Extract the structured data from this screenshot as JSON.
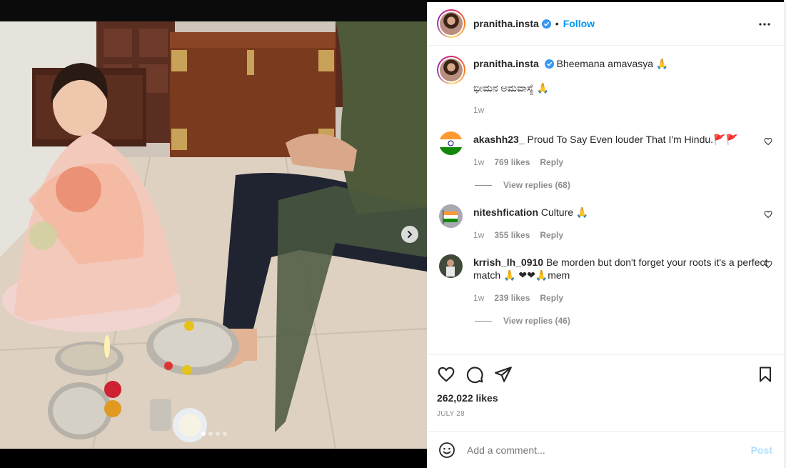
{
  "post": {
    "author": "pranitha.insta",
    "follow_label": "Follow",
    "separator": "•",
    "caption": "Bheemana amavasya 🙏",
    "caption_line2": "ಭೀಮನ ಅಮವಾಸ್ಯೆ 🙏",
    "caption_time": "1w",
    "likes": "262,022 likes",
    "date": "JULY 28"
  },
  "comments": [
    {
      "user": "akashh23_",
      "text": "Proud To Say Even louder That I'm Hindu.🚩🚩",
      "time": "1w",
      "likes": "769 likes",
      "reply_label": "Reply",
      "view_replies": "View replies (68)"
    },
    {
      "user": "niteshfication",
      "text": "Culture 🙏",
      "time": "1w",
      "likes": "355 likes",
      "reply_label": "Reply"
    },
    {
      "user": "krrish_lh_0910",
      "text": "Be morden but don't forget your roots it's a perfect match 🙏 ❤❤🙏mem",
      "time": "1w",
      "likes": "239 likes",
      "reply_label": "Reply",
      "view_replies": "View replies (46)"
    }
  ],
  "add_comment": {
    "placeholder": "Add a comment...",
    "post_label": "Post"
  },
  "carousel": {
    "slides": 4,
    "active_index": 0
  },
  "colors": {
    "accent": "#0095f6",
    "post_disabled": "#b2dffc",
    "muted": "#8e8e8e"
  },
  "icons": [
    "verified-icon",
    "more-options-icon",
    "heart-icon",
    "comment-icon",
    "share-icon",
    "bookmark-icon",
    "emoji-icon",
    "next-arrow-icon"
  ]
}
